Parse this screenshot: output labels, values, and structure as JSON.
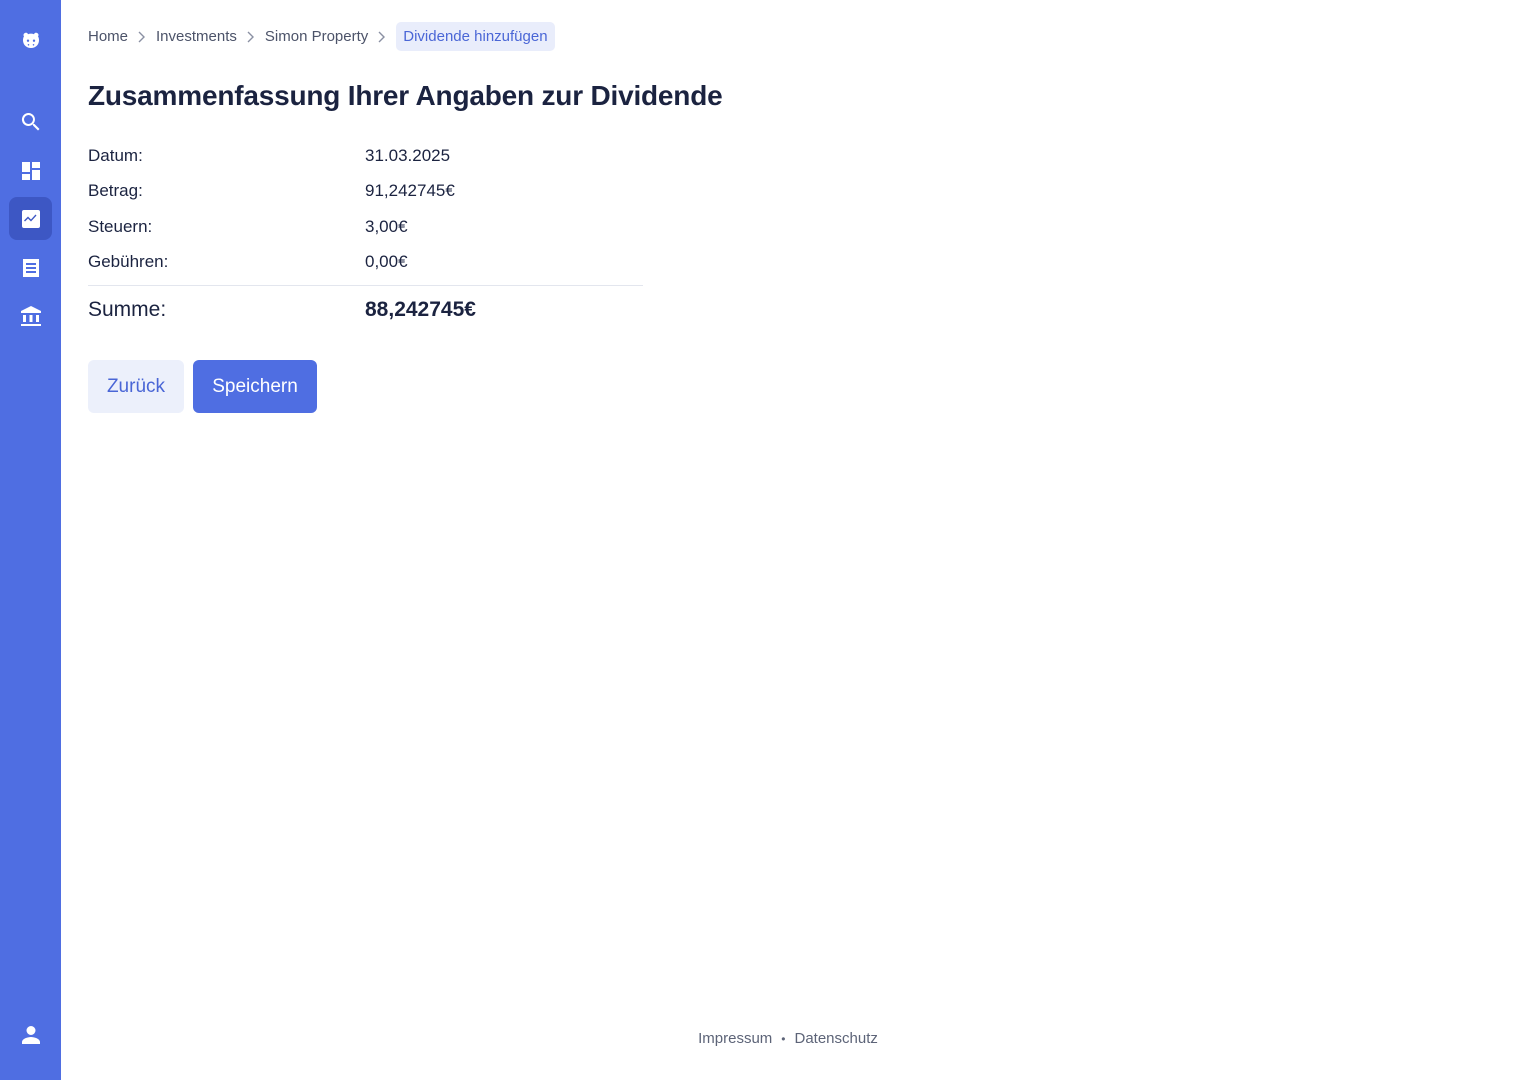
{
  "sidebar": {
    "items": [
      {
        "icon": "hippo-logo-icon"
      },
      {
        "icon": "search-icon"
      },
      {
        "icon": "dashboard-icon"
      },
      {
        "icon": "chart-trend-icon",
        "active": true
      },
      {
        "icon": "list-document-icon"
      },
      {
        "icon": "bank-icon"
      },
      {
        "icon": "user-icon"
      }
    ],
    "accent": "#4f6ee2"
  },
  "breadcrumb": {
    "items": [
      "Home",
      "Investments",
      "Simon Property"
    ],
    "current": "Dividende hinzufügen"
  },
  "title": "Zusammenfassung Ihrer Angaben zur Dividende",
  "summary": {
    "rows": [
      {
        "label": "Datum:",
        "value": "31.03.2025"
      },
      {
        "label": "Betrag:",
        "value": "91,242745€"
      },
      {
        "label": "Steuern:",
        "value": "3,00€"
      },
      {
        "label": "Gebühren:",
        "value": "0,00€"
      }
    ],
    "total": {
      "label": "Summe:",
      "value": "88,242745€"
    }
  },
  "actions": {
    "back": "Zurück",
    "save": "Speichern"
  },
  "footer": {
    "links": [
      "Impressum",
      "Datenschutz"
    ],
    "separator": "•"
  }
}
